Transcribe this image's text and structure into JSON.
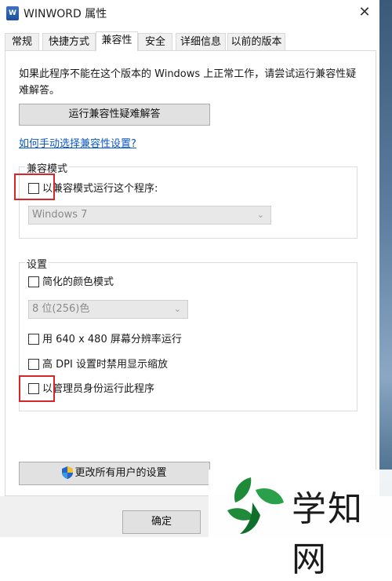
{
  "window": {
    "title": "WINWORD 属性",
    "close_glyph": "✕"
  },
  "tabs": [
    {
      "label": "常规"
    },
    {
      "label": "快捷方式"
    },
    {
      "label": "兼容性"
    },
    {
      "label": "安全"
    },
    {
      "label": "详细信息"
    },
    {
      "label": "以前的版本"
    }
  ],
  "compat_tab": {
    "description": "如果此程序不能在这个版本的 Windows 上正常工作，请尝试运行兼容性疑难解答。",
    "troubleshoot_button": "运行兼容性疑难解答",
    "manual_link": "如何手动选择兼容性设置?",
    "compat_mode": {
      "legend": "兼容模式",
      "checkbox_label": "以兼容模式运行这个程序:",
      "checked": false,
      "os_select": "Windows 7"
    },
    "settings": {
      "legend": "设置",
      "reduced_color_label": "简化的颜色模式",
      "color_select": "8 位(256)色",
      "resolution_label": "用 640 x 480 屏幕分辨率运行",
      "dpi_label": "高 DPI 设置时禁用显示缩放",
      "admin_label": "以管理员身份运行此程序",
      "checked": [
        false,
        false,
        false,
        false
      ]
    },
    "all_users_button": "更改所有用户的设置"
  },
  "footer": {
    "ok_button": "确定"
  },
  "watermark": {
    "text": "学知网"
  },
  "colors": {
    "highlight_red": "#d6262a",
    "link_blue": "#0b57c5"
  }
}
